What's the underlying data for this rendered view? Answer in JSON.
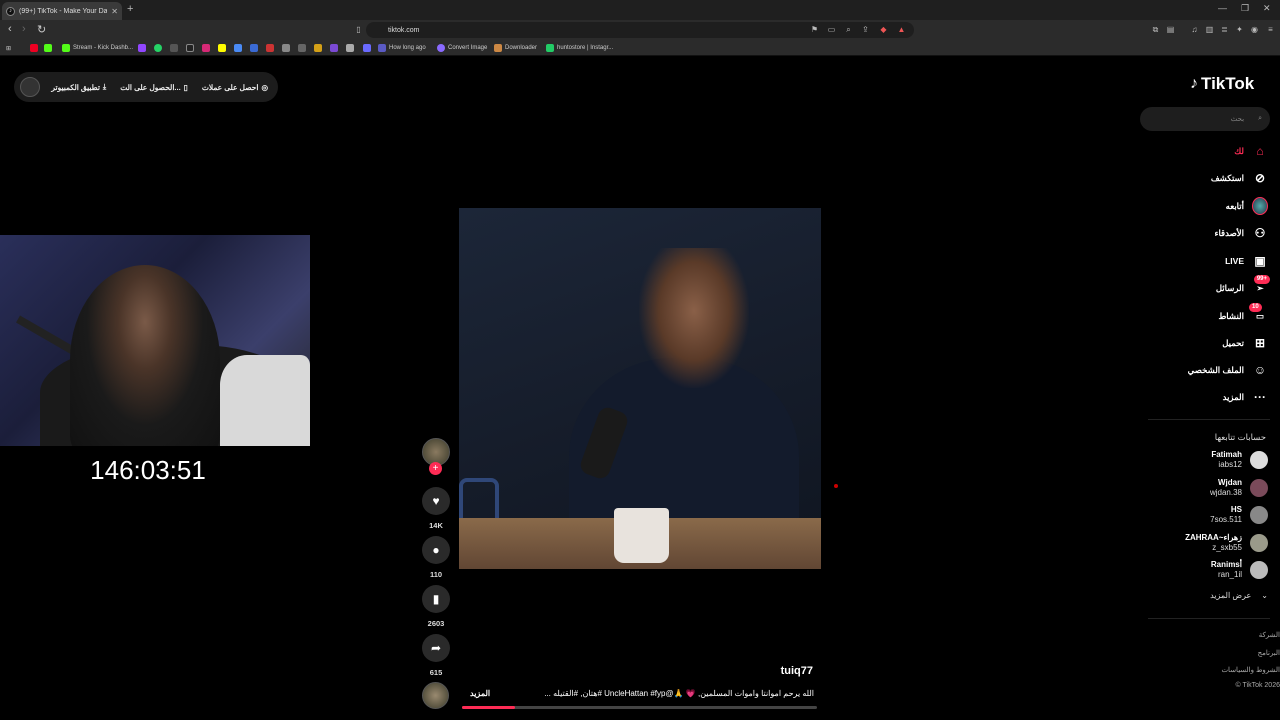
{
  "browser": {
    "tab_title": "(99+) TikTok - Make Your Day",
    "url": "tiktok.com",
    "bookmarks": [
      "Stream - Kick Dashb...",
      "How long ago",
      "Convert Image",
      "Downloader",
      "huntostore | Instagr..."
    ]
  },
  "topbar": {
    "get_coins": "احصل على عملات",
    "get_app": "الحصول على الت...",
    "desktop_app": "تطبيق الكمبيوتر"
  },
  "stream": {
    "timer": "146:03:51"
  },
  "video": {
    "likes": "14K",
    "comments": "110",
    "saves": "2603",
    "shares": "615",
    "author": "tuiq77",
    "caption": "الله يرحم اموانتا واموات المسلمين, 💗 🙏@UncleHattan #fyp #هتان, #القتيله ...",
    "more": "المزيد",
    "progress": 0.15
  },
  "sidebar": {
    "logo": "TikTok",
    "search_placeholder": "بحث",
    "nav": {
      "foryou": "لك",
      "explore": "استكشف",
      "following": "أتابعه",
      "friends": "الأصدقاء",
      "live": "LIVE",
      "messages": "الرسائل",
      "messages_badge": "99+",
      "activity": "النشاط",
      "activity_badge": "10",
      "upload": "تحميل",
      "profile": "الملف الشخصي",
      "more": "المزيد"
    },
    "following_title": "حسابات تتابعها",
    "accounts": [
      {
        "name": "Fatimah",
        "handle": "iabs12"
      },
      {
        "name": "Wjdan",
        "handle": "wjdan.38"
      },
      {
        "name": "HS",
        "handle": "7sos.511"
      },
      {
        "name": "ZAHRAA~زهراء",
        "handle": "z_sxb55"
      },
      {
        "name": "Ranimsأ",
        "handle": "ran_1il"
      }
    ],
    "see_more": "عرض المزيد",
    "footer": [
      "الشركة",
      "البرنامج",
      "الشروط والسياسات",
      "© TikTok 2026"
    ]
  },
  "colors": {
    "accent": "#fe2c55",
    "background": "#000000"
  }
}
